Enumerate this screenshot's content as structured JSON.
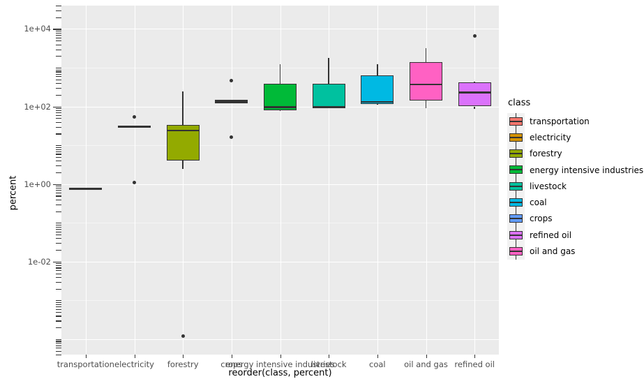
{
  "chart_data": {
    "type": "box",
    "title": "",
    "xlabel": "reorder(class, percent)",
    "ylabel": "percent",
    "yscale": "log10",
    "ylim": [
      0.0001,
      40000
    ],
    "grid": true,
    "legend_position": "right",
    "legend_title": "class",
    "y_ticks": [
      {
        "label": "1e+04",
        "value": 10000
      },
      {
        "label": "1e+02",
        "value": 100
      },
      {
        "label": "1e+00",
        "value": 1
      },
      {
        "label": "1e-02",
        "value": 0.01
      }
    ],
    "categories": [
      "transportation",
      "electricity",
      "forestry",
      "crops",
      "energy intensive industries",
      "livestock",
      "coal",
      "oil and gas",
      "refined oil"
    ],
    "series": [
      {
        "name": "transportation",
        "color": "#f8766d",
        "lower_whisker": 0.76,
        "q1": 0.76,
        "median": 0.76,
        "q3": 0.76,
        "upper_whisker": 0.76,
        "outliers": []
      },
      {
        "name": "electricity",
        "color": "#d39200",
        "lower_whisker": 30.0,
        "q1": 30.0,
        "median": 30.0,
        "q3": 30.0,
        "upper_whisker": 30.0,
        "outliers": [
          54.0,
          1.1
        ]
      },
      {
        "name": "forestry",
        "color": "#93aa00",
        "lower_whisker": 2.4,
        "q1": 4.1,
        "median": 24.0,
        "q3": 33.0,
        "upper_whisker": 250.0,
        "outliers": [
          0.00012
        ]
      },
      {
        "name": "crops",
        "color": "#619cff",
        "lower_whisker": 120.0,
        "q1": 120.0,
        "median": 135.0,
        "q3": 150.0,
        "upper_whisker": 150.0,
        "outliers": [
          470.0,
          16.0
        ]
      },
      {
        "name": "energy intensive industries",
        "color": "#00ba38",
        "lower_whisker": 78.0,
        "q1": 80.0,
        "median": 97.0,
        "q3": 380.0,
        "upper_whisker": 1250.0,
        "outliers": []
      },
      {
        "name": "livestock",
        "color": "#00c19f",
        "lower_whisker": 95.0,
        "q1": 97.0,
        "median": 97.0,
        "q3": 390.0,
        "upper_whisker": 1800.0,
        "outliers": []
      },
      {
        "name": "coal",
        "color": "#00b9e3",
        "lower_whisker": 110.0,
        "q1": 118.0,
        "median": 130.0,
        "q3": 630.0,
        "upper_whisker": 1250.0,
        "outliers": []
      },
      {
        "name": "oil and gas",
        "color": "#ff61c3",
        "lower_whisker": 90.0,
        "q1": 140.0,
        "median": 370.0,
        "q3": 1400.0,
        "upper_whisker": 3200.0,
        "outliers": []
      },
      {
        "name": "refined oil",
        "color": "#db72fb",
        "lower_whisker": 86.0,
        "q1": 100.0,
        "median": 230.0,
        "q3": 420.0,
        "upper_whisker": 440.0,
        "outliers": [
          6500.0
        ]
      }
    ]
  },
  "axes": {
    "y_title": "percent",
    "x_title": "reorder(class, percent)"
  },
  "legend": {
    "title": "class",
    "items": [
      {
        "label": "transportation",
        "color": "#f8766d"
      },
      {
        "label": "electricity",
        "color": "#d39200"
      },
      {
        "label": "forestry",
        "color": "#93aa00"
      },
      {
        "label": "energy intensive industries",
        "color": "#00ba38"
      },
      {
        "label": "livestock",
        "color": "#00c19f"
      },
      {
        "label": "coal",
        "color": "#00b9e3"
      },
      {
        "label": "crops",
        "color": "#619cff"
      },
      {
        "label": "refined oil",
        "color": "#db72fb"
      },
      {
        "label": "oil and gas",
        "color": "#ff61c3"
      }
    ]
  },
  "theme": {
    "panel_background": "#ebebeb",
    "grid_major": "#ffffff",
    "grid_minor": "#f5f5f5",
    "ink": "#333333",
    "tick_label": "#4d4d4d"
  }
}
